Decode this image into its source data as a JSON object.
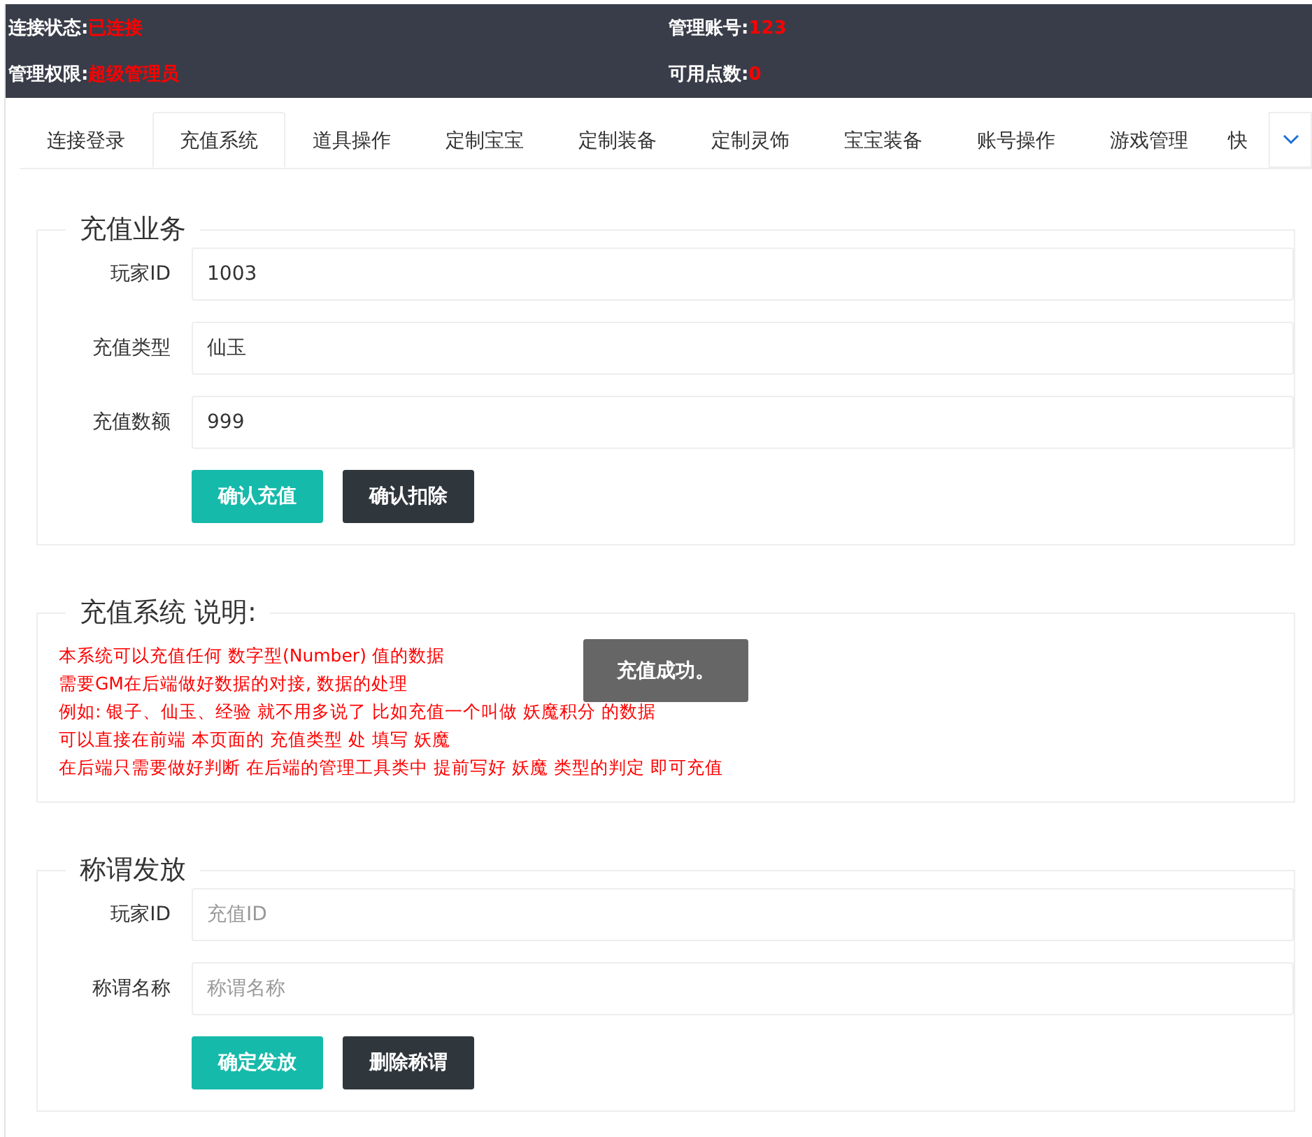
{
  "status": [
    {
      "label": "连接状态:",
      "value": "已连接"
    },
    {
      "label": "管理账号:",
      "value": "123"
    },
    {
      "label": "管理权限:",
      "value": "超级管理员"
    },
    {
      "label": "可用点数:",
      "value": "0"
    }
  ],
  "tabs": [
    {
      "label": "连接登录",
      "selected": false
    },
    {
      "label": "充值系统",
      "selected": true
    },
    {
      "label": "道具操作",
      "selected": false
    },
    {
      "label": "定制宝宝",
      "selected": false
    },
    {
      "label": "定制装备",
      "selected": false
    },
    {
      "label": "定制灵饰",
      "selected": false
    },
    {
      "label": "宝宝装备",
      "selected": false
    },
    {
      "label": "账号操作",
      "selected": false
    },
    {
      "label": "游戏管理",
      "selected": false
    },
    {
      "label": "快",
      "selected": false
    }
  ],
  "recharge": {
    "title": "充值业务",
    "fields": [
      {
        "label": "玩家ID",
        "value": "1003"
      },
      {
        "label": "充值类型",
        "value": "仙玉"
      },
      {
        "label": "充值数额",
        "value": "999"
      }
    ],
    "buttons": [
      {
        "label": "确认充值",
        "kind": "primary"
      },
      {
        "label": "确认扣除",
        "kind": "dark"
      }
    ]
  },
  "notes": {
    "title": "充值系统 说明:",
    "lines": [
      "本系统可以充值任何 数字型(Number) 值的数据",
      "需要GM在后端做好数据的对接, 数据的处理",
      "例如: 银子、仙玉、经验 就不用多说了 比如充值一个叫做 妖魔积分 的数据",
      "可以直接在前端 本页面的 充值类型 处 填写 妖魔",
      "在后端只需要做好判断 在后端的管理工具类中 提前写好 妖魔 类型的判定 即可充值"
    ],
    "toast": "充值成功。"
  },
  "title_grant": {
    "title": "称谓发放",
    "fields": [
      {
        "label": "玩家ID",
        "placeholder": "充值ID"
      },
      {
        "label": "称谓名称",
        "placeholder": "称谓名称"
      }
    ],
    "buttons": [
      {
        "label": "确定发放",
        "kind": "primary"
      },
      {
        "label": "删除称谓",
        "kind": "dark"
      }
    ]
  }
}
